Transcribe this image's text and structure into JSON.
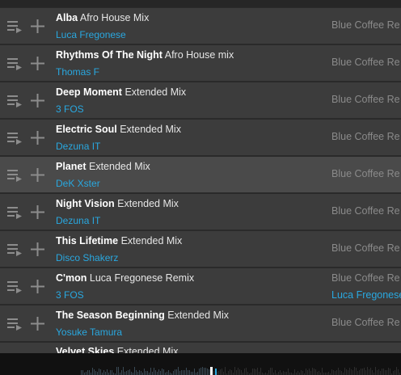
{
  "tracks": [
    {
      "name": "Alba",
      "mix": "Afro House Mix",
      "artist": "Luca Fregonese",
      "label": "Blue Coffee Re"
    },
    {
      "name": "Rhythms Of The Night",
      "mix": "Afro House mix",
      "artist": "Thomas F",
      "label": "Blue Coffee Re"
    },
    {
      "name": "Deep Moment",
      "mix": "Extended Mix",
      "artist": "3 FOS",
      "label": "Blue Coffee Re"
    },
    {
      "name": "Electric Soul",
      "mix": "Extended Mix",
      "artist": "Dezuna IT",
      "label": "Blue Coffee Re"
    },
    {
      "name": "Planet",
      "mix": "Extended Mix",
      "artist": "DeK Xster",
      "label": "Blue Coffee Re"
    },
    {
      "name": "Night Vision",
      "mix": "Extended Mix",
      "artist": "Dezuna IT",
      "label": "Blue Coffee Re"
    },
    {
      "name": "This Lifetime",
      "mix": "Extended Mix",
      "artist": "Disco Shakerz",
      "label": "Blue Coffee Re"
    },
    {
      "name": "C'mon",
      "mix": "Luca Fregonese Remix",
      "artist": "3 FOS",
      "label": "Blue Coffee Re",
      "label_artist": "Luca Fregonese"
    },
    {
      "name": "The Season Beginning",
      "mix": "Extended Mix",
      "artist": "Yosuke Tamura",
      "label": "Blue Coffee Re"
    },
    {
      "name": "Velvet Skies",
      "mix": "Extended Mix"
    }
  ],
  "icons": {
    "queue": "add-to-queue-icon",
    "add": "plus-icon",
    "playhead": "playhead-marker-icon"
  },
  "colors": {
    "artist": "#29a8e0",
    "label": "#8a8a8a",
    "row": "#3c3c3c",
    "row_highlight": "#4a4a4a"
  }
}
